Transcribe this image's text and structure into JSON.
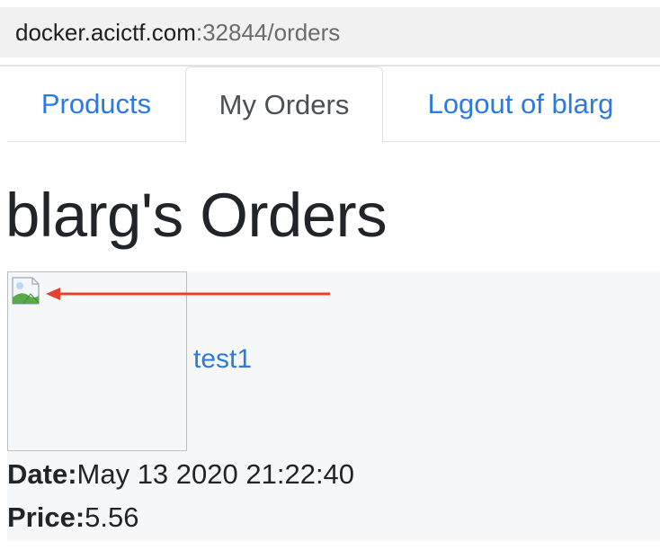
{
  "browser": {
    "url_host": "docker.acictf.com",
    "url_path": ":32844/orders"
  },
  "nav": {
    "tabs": [
      {
        "label": "Products",
        "active": false
      },
      {
        "label": "My Orders",
        "active": true
      },
      {
        "label": "Logout of blarg",
        "active": false
      }
    ]
  },
  "page": {
    "title": "blarg's Orders"
  },
  "order": {
    "image_icon": "broken-image-icon",
    "item_link": "test1",
    "date_label": "Date:",
    "date_value": "May 13 2020 21:22:40",
    "price_label": "Price:",
    "price_value": "5.56"
  },
  "annotation": {
    "arrow_color": "#e8402f"
  },
  "colors": {
    "link": "#2a7ae2",
    "text": "#212529",
    "card_bg": "#f6f7f9"
  }
}
